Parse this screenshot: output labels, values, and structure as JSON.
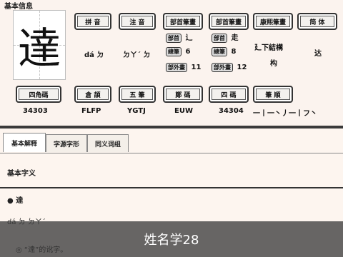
{
  "header": {
    "title": "基本信息"
  },
  "character": {
    "glyph": "達"
  },
  "row1_labels": [
    "拼 音",
    "注 音",
    "部首筆畫",
    "部首筆畫",
    "康熙筆畫",
    "简 体"
  ],
  "row1_values": {
    "pinyin": "dá ㄉ",
    "zhuyin": "ㄉㄚˊ ㄉ",
    "radical_a": {
      "chips": [
        "部首",
        "總筆",
        "部外畫"
      ],
      "values": [
        "辶",
        "6",
        "11"
      ]
    },
    "radical_b": {
      "chips": [
        "部首",
        "總筆",
        "部外畫"
      ],
      "values": [
        "走",
        "8",
        "12"
      ]
    },
    "kangxi": "廴下結構",
    "kangxi2": "构",
    "simplified": "达"
  },
  "row2_labels": [
    "四角碼",
    "倉 頡",
    "五 筆",
    "鄭 碼",
    "四 碼",
    "筆 順"
  ],
  "row2_values": [
    "34303",
    "FLFP",
    "YGTJ",
    "EUW",
    "34304",
    "一丨一丶丿一丨フ丶"
  ],
  "tabs": [
    "基本解释",
    "字源字形",
    "同义词组"
  ],
  "sections": {
    "basic": "基本字义",
    "bullet": "● 達",
    "pinyin_line": "dá ㄉ ㄉㄚˊ",
    "example": "◎ “達”的讹字。"
  },
  "caption": "姓名学28"
}
